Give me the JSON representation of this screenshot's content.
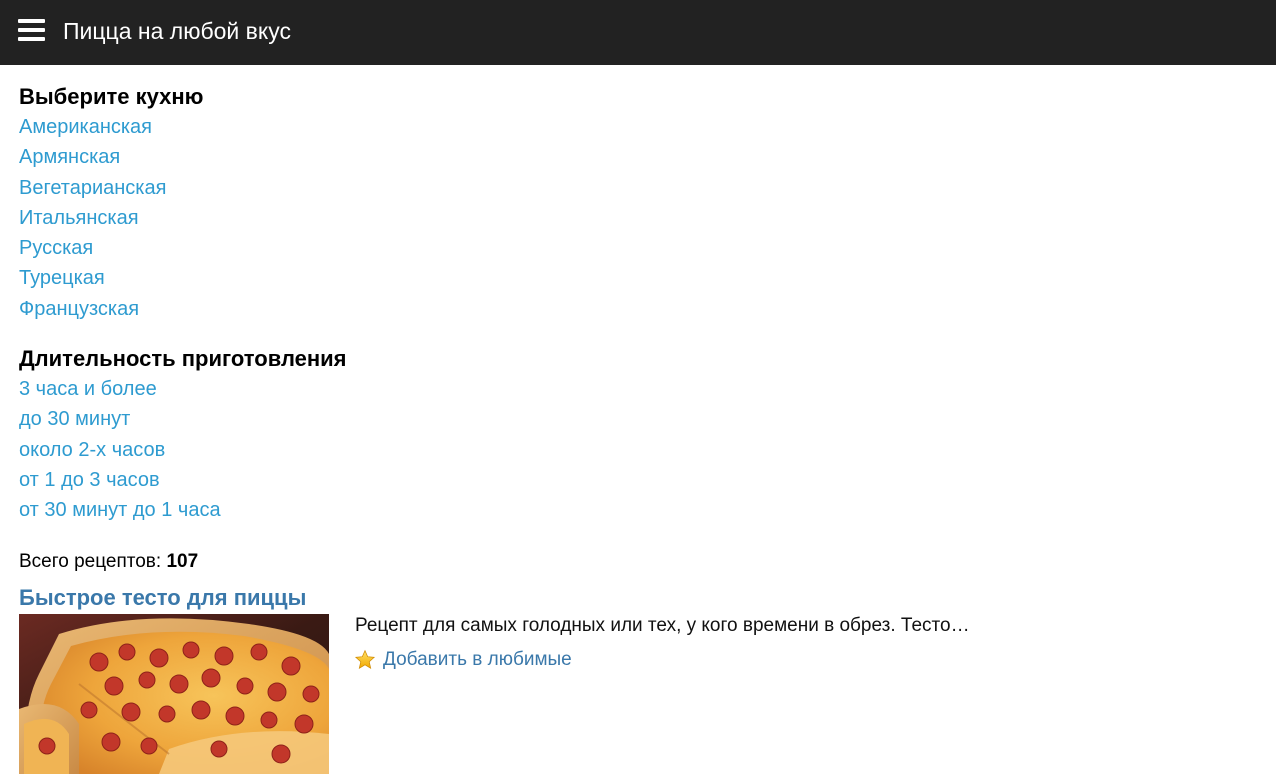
{
  "header": {
    "menu_icon": "hamburger-menu-icon",
    "title": "Пицца на любой вкус",
    "background": "#222222"
  },
  "filters": {
    "cuisine": {
      "heading": "Выберите кухню",
      "items": [
        "Американская",
        "Армянская",
        "Вегетарианская",
        "Итальянская",
        "Русская",
        "Турецкая",
        "Французская"
      ]
    },
    "duration": {
      "heading": "Длительность приготовления",
      "items": [
        "3 часа и более",
        "до 30 минут",
        "около 2-х часов",
        "от 1 до 3 часов",
        "от 30 минут до 1 часа"
      ]
    },
    "link_color": "#2e9bd0"
  },
  "summary": {
    "label": "Всего рецептов:",
    "count": "107"
  },
  "recipes": [
    {
      "title": "Быстрое тесто для пиццы",
      "description": "Рецепт для самых голодных или тех, у кого времени в обрез. Тесто…",
      "favorite_label": "Добавить в любимые",
      "favorite_icon": "star-icon",
      "image": "pepperoni-pizza-photo"
    }
  ],
  "accent_color": "#3a78aa"
}
